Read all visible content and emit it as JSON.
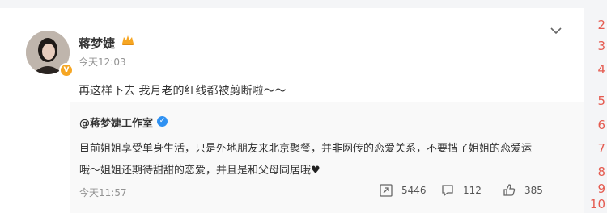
{
  "post": {
    "author": "蒋梦婕",
    "time": "今天12:03",
    "text": "再这样下去 我月老的红线都被剪断啦～～"
  },
  "repost": {
    "author": "@蒋梦婕工作室",
    "line1": "目前姐姐享受单身生活，只是外地朋友来北京聚餐，并非网传的恋爱关系，不要挡了姐姐的恋爱运",
    "line2": "哦～姐姐还期待甜甜的恋爱，并且是和父母同居哦",
    "time": "今天11:57",
    "forward_count": "5446",
    "comment_count": "112",
    "like_count": "385"
  },
  "side_numbers": [
    "2",
    "3",
    "4",
    "5",
    "6",
    "7",
    "8",
    "9",
    "10"
  ],
  "colors": {
    "verified_blue": "#2f91f2",
    "crown_orange": "#f6a623",
    "side_red": "#e55b50"
  },
  "icons": [
    "crown-icon",
    "chevron-down-icon",
    "verified-icon",
    "heart-icon",
    "forward-icon",
    "comment-icon",
    "like-icon"
  ]
}
